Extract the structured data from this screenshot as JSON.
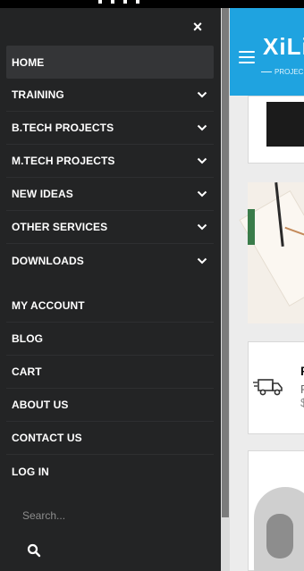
{
  "drawer": {
    "close_label": "×",
    "menu_group_1": [
      {
        "label": "HOME",
        "has_submenu": false,
        "active": true
      },
      {
        "label": "TRAINING",
        "has_submenu": true
      },
      {
        "label": "B.TECH PROJECTS",
        "has_submenu": true
      },
      {
        "label": "M.TECH PROJECTS",
        "has_submenu": true
      },
      {
        "label": "NEW IDEAS",
        "has_submenu": true
      },
      {
        "label": "OTHER SERVICES",
        "has_submenu": true
      },
      {
        "label": "DOWNLOADS",
        "has_submenu": true
      }
    ],
    "menu_group_2": [
      {
        "label": "MY ACCOUNT"
      },
      {
        "label": "BLOG"
      },
      {
        "label": "CART"
      },
      {
        "label": "ABOUT US"
      },
      {
        "label": "CONTACT US"
      },
      {
        "label": "LOG IN"
      }
    ],
    "search": {
      "placeholder": "Search..."
    }
  },
  "site": {
    "logo_text": "XiLi",
    "tagline": "PROJEC",
    "header_color": "#1fa3e0"
  },
  "cards": {
    "feature_title": "F",
    "feature_line1": "F",
    "feature_line2": "$"
  },
  "icons": {
    "close": "close-icon",
    "chevron": "chevron-down-icon",
    "search": "search-icon",
    "menu": "hamburger-menu-icon",
    "delivery": "delivery-truck-icon"
  }
}
